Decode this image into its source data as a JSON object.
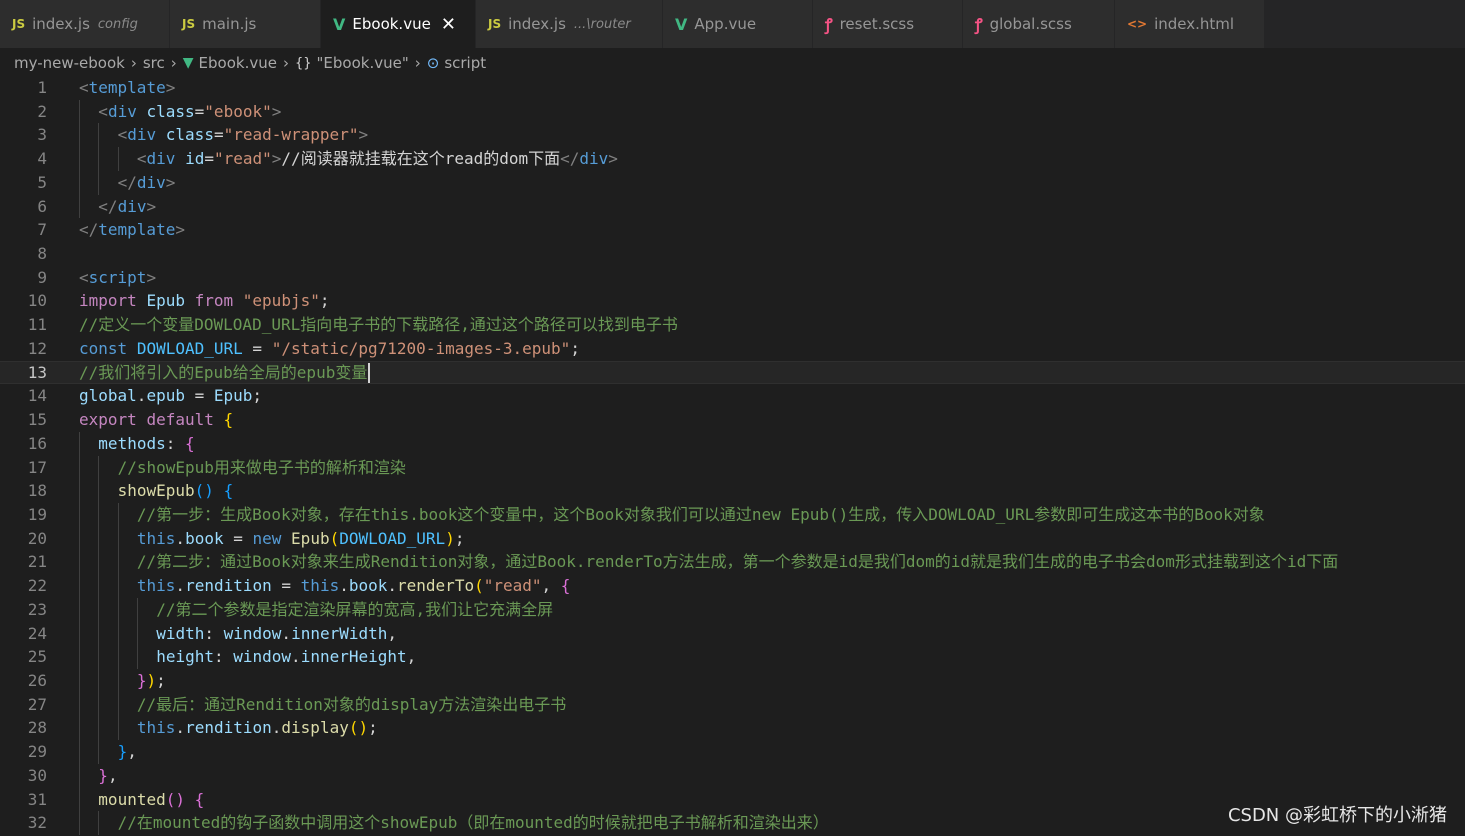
{
  "tabs": [
    {
      "label": "index.js",
      "desc": "config",
      "icon": "js-file-icon",
      "glyph": "JS",
      "active": false,
      "width": 170
    },
    {
      "label": "main.js",
      "icon": "js-file-icon",
      "glyph": "JS",
      "active": false,
      "width": 151
    },
    {
      "label": "Ebook.vue",
      "icon": "vue-file-icon",
      "glyph": "V",
      "active": true,
      "close": "✕",
      "width": 155
    },
    {
      "label": "index.js",
      "desc": "...\\router",
      "icon": "js-file-icon",
      "glyph": "JS",
      "active": false,
      "width": 187
    },
    {
      "label": "App.vue",
      "icon": "vue-file-icon",
      "glyph": "V",
      "active": false,
      "width": 150
    },
    {
      "label": "reset.scss",
      "icon": "scss-file-icon",
      "glyph": "ꝭ",
      "active": false,
      "width": 150
    },
    {
      "label": "global.scss",
      "icon": "scss-file-icon",
      "glyph": "ꝭ",
      "active": false,
      "width": 152
    },
    {
      "label": "index.html",
      "icon": "html-file-icon",
      "glyph": "<>",
      "active": false,
      "width": 150
    }
  ],
  "breadcrumb": {
    "project": "my-new-ebook",
    "folder": "src",
    "file": "Ebook.vue",
    "component": "\"Ebook.vue\"",
    "section": "script",
    "icons": {
      "file": "vue-file-icon",
      "component": "braces-icon",
      "section": "symbol-icon"
    }
  },
  "colors": {
    "tag": "#808080",
    "tagName": "#569cd6",
    "attr": "#9cdcfe",
    "string": "#ce9178",
    "comment": "#6a9955",
    "keyword": "#c586c0",
    "storage": "#569cd6",
    "class": "#4ec9b0",
    "variable": "#9cdcfe",
    "function": "#dcdcaa",
    "text": "#d4d4d4",
    "bracket1": "#ffd700",
    "bracket2": "#da70d6",
    "bracket3": "#179fff",
    "constant": "#4fc1ff"
  },
  "editor": {
    "current_line": 13,
    "lines": [
      {
        "n": "1",
        "indent": 0,
        "tokens": [
          [
            "<",
            "tag"
          ],
          [
            "template",
            "tagName"
          ],
          [
            ">",
            "tag"
          ]
        ]
      },
      {
        "n": "2",
        "indent": 1,
        "tokens": [
          [
            "<",
            "tag"
          ],
          [
            "div",
            "tagName"
          ],
          [
            " ",
            "text"
          ],
          [
            "class",
            "attr"
          ],
          [
            "=",
            "text"
          ],
          [
            "\"ebook\"",
            "string"
          ],
          [
            ">",
            "tag"
          ]
        ]
      },
      {
        "n": "3",
        "indent": 2,
        "tokens": [
          [
            "<",
            "tag"
          ],
          [
            "div",
            "tagName"
          ],
          [
            " ",
            "text"
          ],
          [
            "class",
            "attr"
          ],
          [
            "=",
            "text"
          ],
          [
            "\"read-wrapper\"",
            "string"
          ],
          [
            ">",
            "tag"
          ]
        ]
      },
      {
        "n": "4",
        "indent": 3,
        "tokens": [
          [
            "<",
            "tag"
          ],
          [
            "div",
            "tagName"
          ],
          [
            " ",
            "text"
          ],
          [
            "id",
            "attr"
          ],
          [
            "=",
            "text"
          ],
          [
            "\"read\"",
            "string"
          ],
          [
            ">",
            "tag"
          ],
          [
            "//阅读器就挂载在这个read的dom下面",
            "text"
          ],
          [
            "</",
            "tag"
          ],
          [
            "div",
            "tagName"
          ],
          [
            ">",
            "tag"
          ]
        ]
      },
      {
        "n": "5",
        "indent": 2,
        "tokens": [
          [
            "</",
            "tag"
          ],
          [
            "div",
            "tagName"
          ],
          [
            ">",
            "tag"
          ]
        ]
      },
      {
        "n": "6",
        "indent": 1,
        "tokens": [
          [
            "</",
            "tag"
          ],
          [
            "div",
            "tagName"
          ],
          [
            ">",
            "tag"
          ]
        ]
      },
      {
        "n": "7",
        "indent": 0,
        "tokens": [
          [
            "</",
            "tag"
          ],
          [
            "template",
            "tagName"
          ],
          [
            ">",
            "tag"
          ]
        ]
      },
      {
        "n": "8",
        "indent": 0,
        "tokens": []
      },
      {
        "n": "9",
        "indent": 0,
        "tokens": [
          [
            "<",
            "tag"
          ],
          [
            "script",
            "tagName"
          ],
          [
            ">",
            "tag"
          ]
        ]
      },
      {
        "n": "10",
        "indent": 0,
        "tokens": [
          [
            "import",
            "keyword"
          ],
          [
            " ",
            "text"
          ],
          [
            "Epub",
            "variable"
          ],
          [
            " ",
            "text"
          ],
          [
            "from",
            "keyword"
          ],
          [
            " ",
            "text"
          ],
          [
            "\"epubjs\"",
            "string"
          ],
          [
            ";",
            "text"
          ]
        ]
      },
      {
        "n": "11",
        "indent": 0,
        "tokens": [
          [
            "//定义一个变量DOWLOAD_URL指向电子书的下载路径,通过这个路径可以找到电子书",
            "comment"
          ]
        ]
      },
      {
        "n": "12",
        "indent": 0,
        "tokens": [
          [
            "const",
            "storage"
          ],
          [
            " ",
            "text"
          ],
          [
            "DOWLOAD_URL",
            "constant"
          ],
          [
            " = ",
            "text"
          ],
          [
            "\"/static/pg71200-images-3.epub\"",
            "string"
          ],
          [
            ";",
            "text"
          ]
        ]
      },
      {
        "n": "13",
        "indent": 0,
        "tokens": [
          [
            "//我们将引入的Epub给全局的epub变量",
            "comment"
          ]
        ]
      },
      {
        "n": "14",
        "indent": 0,
        "tokens": [
          [
            "global",
            "variable"
          ],
          [
            ".",
            "text"
          ],
          [
            "epub",
            "variable"
          ],
          [
            " = ",
            "text"
          ],
          [
            "Epub",
            "variable"
          ],
          [
            ";",
            "text"
          ]
        ]
      },
      {
        "n": "15",
        "indent": 0,
        "tokens": [
          [
            "export",
            "keyword"
          ],
          [
            " ",
            "text"
          ],
          [
            "default",
            "keyword"
          ],
          [
            " ",
            "text"
          ],
          [
            "{",
            "bracket1"
          ]
        ]
      },
      {
        "n": "16",
        "indent": 1,
        "tokens": [
          [
            "methods",
            "variable"
          ],
          [
            ": ",
            "text"
          ],
          [
            "{",
            "bracket2"
          ]
        ]
      },
      {
        "n": "17",
        "indent": 2,
        "tokens": [
          [
            "//showEpub用来做电子书的解析和渲染",
            "comment"
          ]
        ]
      },
      {
        "n": "18",
        "indent": 2,
        "tokens": [
          [
            "showEpub",
            "function"
          ],
          [
            "()",
            "bracket3"
          ],
          [
            " ",
            "text"
          ],
          [
            "{",
            "bracket3"
          ]
        ]
      },
      {
        "n": "19",
        "indent": 3,
        "tokens": [
          [
            "//第一步：生成Book对象，存在this.book这个变量中，这个Book对象我们可以通过new Epub()生成，传入DOWLOAD_URL参数即可生成这本书的Book对象",
            "comment"
          ]
        ]
      },
      {
        "n": "20",
        "indent": 3,
        "tokens": [
          [
            "this",
            "storage"
          ],
          [
            ".",
            "text"
          ],
          [
            "book",
            "variable"
          ],
          [
            " = ",
            "text"
          ],
          [
            "new",
            "storage"
          ],
          [
            " ",
            "text"
          ],
          [
            "Epub",
            "function"
          ],
          [
            "(",
            "bracket1"
          ],
          [
            "DOWLOAD_URL",
            "constant"
          ],
          [
            ")",
            "bracket1"
          ],
          [
            ";",
            "text"
          ]
        ]
      },
      {
        "n": "21",
        "indent": 3,
        "tokens": [
          [
            "//第二步：通过Book对象来生成Rendition对象，通过Book.renderTo方法生成，第一个参数是id是我们dom的id就是我们生成的电子书会dom形式挂载到这个id下面",
            "comment"
          ]
        ]
      },
      {
        "n": "22",
        "indent": 3,
        "tokens": [
          [
            "this",
            "storage"
          ],
          [
            ".",
            "text"
          ],
          [
            "rendition",
            "variable"
          ],
          [
            " = ",
            "text"
          ],
          [
            "this",
            "storage"
          ],
          [
            ".",
            "text"
          ],
          [
            "book",
            "variable"
          ],
          [
            ".",
            "text"
          ],
          [
            "renderTo",
            "function"
          ],
          [
            "(",
            "bracket1"
          ],
          [
            "\"read\"",
            "string"
          ],
          [
            ", ",
            "text"
          ],
          [
            "{",
            "bracket2"
          ]
        ]
      },
      {
        "n": "23",
        "indent": 4,
        "tokens": [
          [
            "//第二个参数是指定渲染屏幕的宽高,我们让它充满全屏",
            "comment"
          ]
        ]
      },
      {
        "n": "24",
        "indent": 4,
        "tokens": [
          [
            "width",
            "variable"
          ],
          [
            ": ",
            "text"
          ],
          [
            "window",
            "variable"
          ],
          [
            ".",
            "text"
          ],
          [
            "innerWidth",
            "variable"
          ],
          [
            ",",
            "text"
          ]
        ]
      },
      {
        "n": "25",
        "indent": 4,
        "tokens": [
          [
            "height",
            "variable"
          ],
          [
            ": ",
            "text"
          ],
          [
            "window",
            "variable"
          ],
          [
            ".",
            "text"
          ],
          [
            "innerHeight",
            "variable"
          ],
          [
            ",",
            "text"
          ]
        ]
      },
      {
        "n": "26",
        "indent": 3,
        "tokens": [
          [
            "}",
            "bracket2"
          ],
          [
            ")",
            "bracket1"
          ],
          [
            ";",
            "text"
          ]
        ]
      },
      {
        "n": "27",
        "indent": 3,
        "tokens": [
          [
            "//最后：通过Rendition对象的display方法渲染出电子书",
            "comment"
          ]
        ]
      },
      {
        "n": "28",
        "indent": 3,
        "tokens": [
          [
            "this",
            "storage"
          ],
          [
            ".",
            "text"
          ],
          [
            "rendition",
            "variable"
          ],
          [
            ".",
            "text"
          ],
          [
            "display",
            "function"
          ],
          [
            "()",
            "bracket1"
          ],
          [
            ";",
            "text"
          ]
        ]
      },
      {
        "n": "29",
        "indent": 2,
        "tokens": [
          [
            "}",
            "bracket3"
          ],
          [
            ",",
            "text"
          ]
        ]
      },
      {
        "n": "30",
        "indent": 1,
        "tokens": [
          [
            "}",
            "bracket2"
          ],
          [
            ",",
            "text"
          ]
        ]
      },
      {
        "n": "31",
        "indent": 1,
        "tokens": [
          [
            "mounted",
            "function"
          ],
          [
            "()",
            "bracket2"
          ],
          [
            " ",
            "text"
          ],
          [
            "{",
            "bracket2"
          ]
        ]
      },
      {
        "n": "32",
        "indent": 2,
        "tokens": [
          [
            "//在mounted的钩子函数中调用这个showEpub（即在mounted的时候就把电子书解析和渲染出来）",
            "comment"
          ]
        ]
      }
    ]
  },
  "watermark": "CSDN @彩虹桥下的小淅猪"
}
